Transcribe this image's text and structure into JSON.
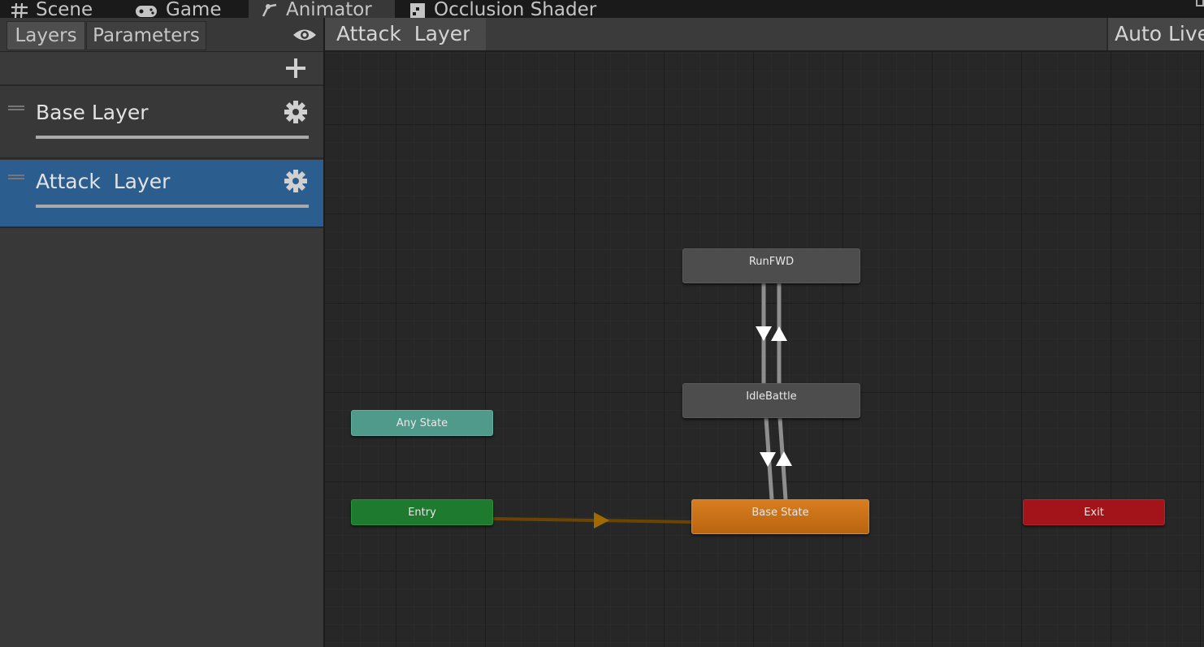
{
  "tabs": [
    {
      "label": "Scene",
      "icon": "grid-hash-icon"
    },
    {
      "label": "Game",
      "icon": "gamepad-icon"
    },
    {
      "label": "Animator",
      "icon": "animator-icon",
      "active": true
    },
    {
      "label": "Occlusion Shader",
      "icon": "shader-icon"
    }
  ],
  "left_panel": {
    "segments": {
      "layers": "Layers",
      "parameters": "Parameters"
    },
    "layers": [
      {
        "name": "Base Layer",
        "weight": 1.0,
        "selected": false
      },
      {
        "name": "Attack  Layer",
        "weight": 1.0,
        "selected": true
      }
    ]
  },
  "graph": {
    "breadcrumb": "Attack  Layer",
    "auto_live": "Auto Live Link",
    "nodes": {
      "runfwd": "RunFWD",
      "idle": "IdleBattle",
      "base_state": "Base State",
      "any_state": "Any State",
      "entry": "Entry",
      "exit": "Exit"
    }
  },
  "colors": {
    "selected_layer": "#2c5d8f",
    "default_state": "#c7701a",
    "any_state": "#4f9a8a",
    "entry": "#1d7a2f",
    "exit": "#a3141a",
    "default_transition": "#8a5a00"
  }
}
